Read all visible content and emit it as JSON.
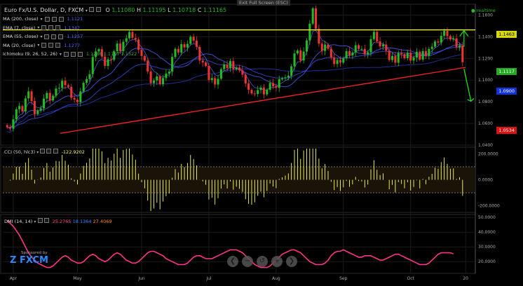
{
  "exit_fullscreen": "Exit Full Screen (ESC)",
  "header": {
    "symbol": "Euro Fx/U.S. Dollar, D, FXCM",
    "o_label": "O",
    "o": "1.11080",
    "h_label": "H",
    "h": "1.11195",
    "l_label": "L",
    "l": "1.10718",
    "c_label": "C",
    "c": "1.11165",
    "realtime": "realtime"
  },
  "indicators": [
    {
      "label": "MA (200, close)",
      "value": "1.1121",
      "color": "#5566ff"
    },
    {
      "label": "EMA (7, close)",
      "value": "1.1347",
      "color": "#5566ff"
    },
    {
      "label": "EMA (55, close)",
      "value": "1.1257",
      "color": "#5566ff"
    },
    {
      "label": "MA (20, close)",
      "value": "1.1277",
      "color": "#5566ff"
    },
    {
      "label": "Ichimoku (9, 26, 52, 26)",
      "value": "1.1286  1.1117  1.1322",
      "color": "#44aa44"
    }
  ],
  "price_tags": {
    "resistance": "1.1463",
    "last": "1.1117",
    "blue": "1.0900",
    "red": "1.0534"
  },
  "cci": {
    "label": "CCI (50, hlc3)",
    "value": "-122.9202"
  },
  "dmi": {
    "label": "DMI (14, 14)",
    "v1": "25.2765",
    "v2": "18.1364",
    "v3": "27.4069"
  },
  "sponsor": {
    "line1": "Sponsored by",
    "brand": "FXCM"
  },
  "colors": {
    "up": "#22bb22",
    "down": "#ee3333",
    "resistance": "#ffff00",
    "trendline": "#ff2222",
    "cci_line": "#ffff66",
    "dmi_line": "#ff3388"
  },
  "chart_data": [
    {
      "type": "candlestick",
      "title": "Euro Fx/U.S. Dollar, D, FXCM",
      "x_ticks": [
        "Apr",
        "May",
        "Jun",
        "Jul",
        "Aug",
        "Sep",
        "Oct",
        "20"
      ],
      "y_ticks": [
        "1.1600",
        "1.1400",
        "1.1200",
        "1.1000",
        "1.0800",
        "1.0600",
        "1.0400"
      ],
      "ylim": [
        1.04,
        1.17
      ],
      "resistance_level": 1.1463,
      "trendline": [
        [
          4,
          1.0534
        ],
        [
          150,
          1.1117
        ]
      ],
      "close": [
        1.0565,
        1.0551,
        1.0638,
        1.0731,
        1.076,
        1.0711,
        1.0831,
        1.0896,
        1.0807,
        1.0686,
        1.072,
        1.0739,
        1.0829,
        1.0882,
        1.0813,
        1.0856,
        1.0922,
        1.0928,
        1.0994,
        1.0953,
        1.0938,
        1.0836,
        1.0819,
        1.0796,
        1.0896,
        1.0975,
        1.1009,
        1.1055,
        1.1213,
        1.1264,
        1.1285,
        1.1217,
        1.1131,
        1.1192,
        1.1187,
        1.1266,
        1.1337,
        1.1268,
        1.1354,
        1.1386,
        1.1444,
        1.139,
        1.1374,
        1.1279,
        1.1222,
        1.118,
        1.1079,
        1.0971,
        1.0996,
        1.1034,
        1.0962,
        1.1018,
        1.106,
        1.1078,
        1.1213,
        1.1288,
        1.1254,
        1.1331,
        1.1301,
        1.1334,
        1.14,
        1.1364,
        1.1306,
        1.118,
        1.1162,
        1.1131,
        1.1001,
        1.1018,
        1.0959,
        1.1012,
        1.1101,
        1.1143,
        1.111,
        1.1175,
        1.1099,
        1.1116,
        1.109,
        1.105,
        1.097,
        1.091,
        1.0877,
        1.0872,
        1.0908,
        1.0931,
        1.0868,
        1.0911,
        1.0973,
        1.0944,
        1.0928,
        1.1008,
        1.1016,
        1.1025,
        1.104,
        1.1127,
        1.1246,
        1.1273,
        1.1181,
        1.1263,
        1.1366,
        1.1521,
        1.1662,
        1.1474,
        1.1336,
        1.1269,
        1.1328,
        1.1289,
        1.1208,
        1.1148,
        1.1186,
        1.1161,
        1.1201,
        1.1267,
        1.1227,
        1.1254,
        1.1322,
        1.1287,
        1.1288,
        1.1236,
        1.1256,
        1.1378,
        1.1445,
        1.1357,
        1.1311,
        1.1328,
        1.1271,
        1.1185,
        1.1223,
        1.116,
        1.1251,
        1.1239,
        1.1202,
        1.1253,
        1.118,
        1.1208,
        1.1262,
        1.1189,
        1.1268,
        1.1222,
        1.1287,
        1.1308,
        1.1356,
        1.1346,
        1.1408,
        1.1454,
        1.1406,
        1.1374,
        1.1385,
        1.1303,
        1.132,
        1.1165
      ],
      "ma_series": [
        "MA (200, close)",
        "EMA (7, close)",
        "EMA (55, close)",
        "MA (20, close)",
        "Ichimoku (9, 26, 52, 26)"
      ]
    },
    {
      "type": "bar",
      "title": "CCI (50, hlc3)",
      "ylim": [
        -250,
        250
      ],
      "y_ticks": [
        "200.0000",
        "0.0000",
        "-200.0000"
      ],
      "bands": [
        100,
        -100
      ],
      "last": -122.9202
    },
    {
      "type": "line",
      "title": "DMI (14, 14)",
      "ylim": [
        12,
        52
      ],
      "y_ticks": [
        "50.0000",
        "40.0000",
        "30.0000",
        "20.0000"
      ],
      "values": [
        48,
        46,
        44,
        41,
        38,
        34,
        30,
        26,
        23,
        21,
        19,
        18,
        17,
        16,
        16,
        17,
        19,
        21,
        23,
        24,
        23,
        21,
        20,
        19,
        19,
        20,
        22,
        24,
        25,
        24,
        22,
        21,
        20,
        21,
        23,
        25,
        26,
        25,
        23,
        21,
        20,
        19,
        19,
        20,
        22,
        24,
        26,
        27,
        27,
        26,
        25,
        24,
        22,
        21,
        20,
        19,
        18,
        18,
        18,
        19,
        21,
        23,
        24,
        24,
        23,
        22,
        22,
        22,
        23,
        24,
        25,
        26,
        27,
        28,
        28,
        28,
        27,
        26,
        24,
        22,
        20,
        18,
        17,
        16,
        16,
        16,
        17,
        19,
        21,
        23,
        25,
        26,
        27,
        28,
        28,
        27,
        26,
        24,
        22,
        20,
        19,
        18,
        18,
        18,
        19,
        21,
        24,
        26,
        27,
        27,
        28,
        27,
        26,
        25,
        24,
        23,
        23,
        24,
        24,
        24,
        23,
        22,
        21,
        21,
        22,
        23,
        24,
        25,
        25,
        24,
        23,
        22,
        21,
        20,
        19,
        18,
        18,
        18,
        19,
        21,
        23,
        25,
        26,
        26,
        26,
        26,
        25.3
      ]
    }
  ]
}
